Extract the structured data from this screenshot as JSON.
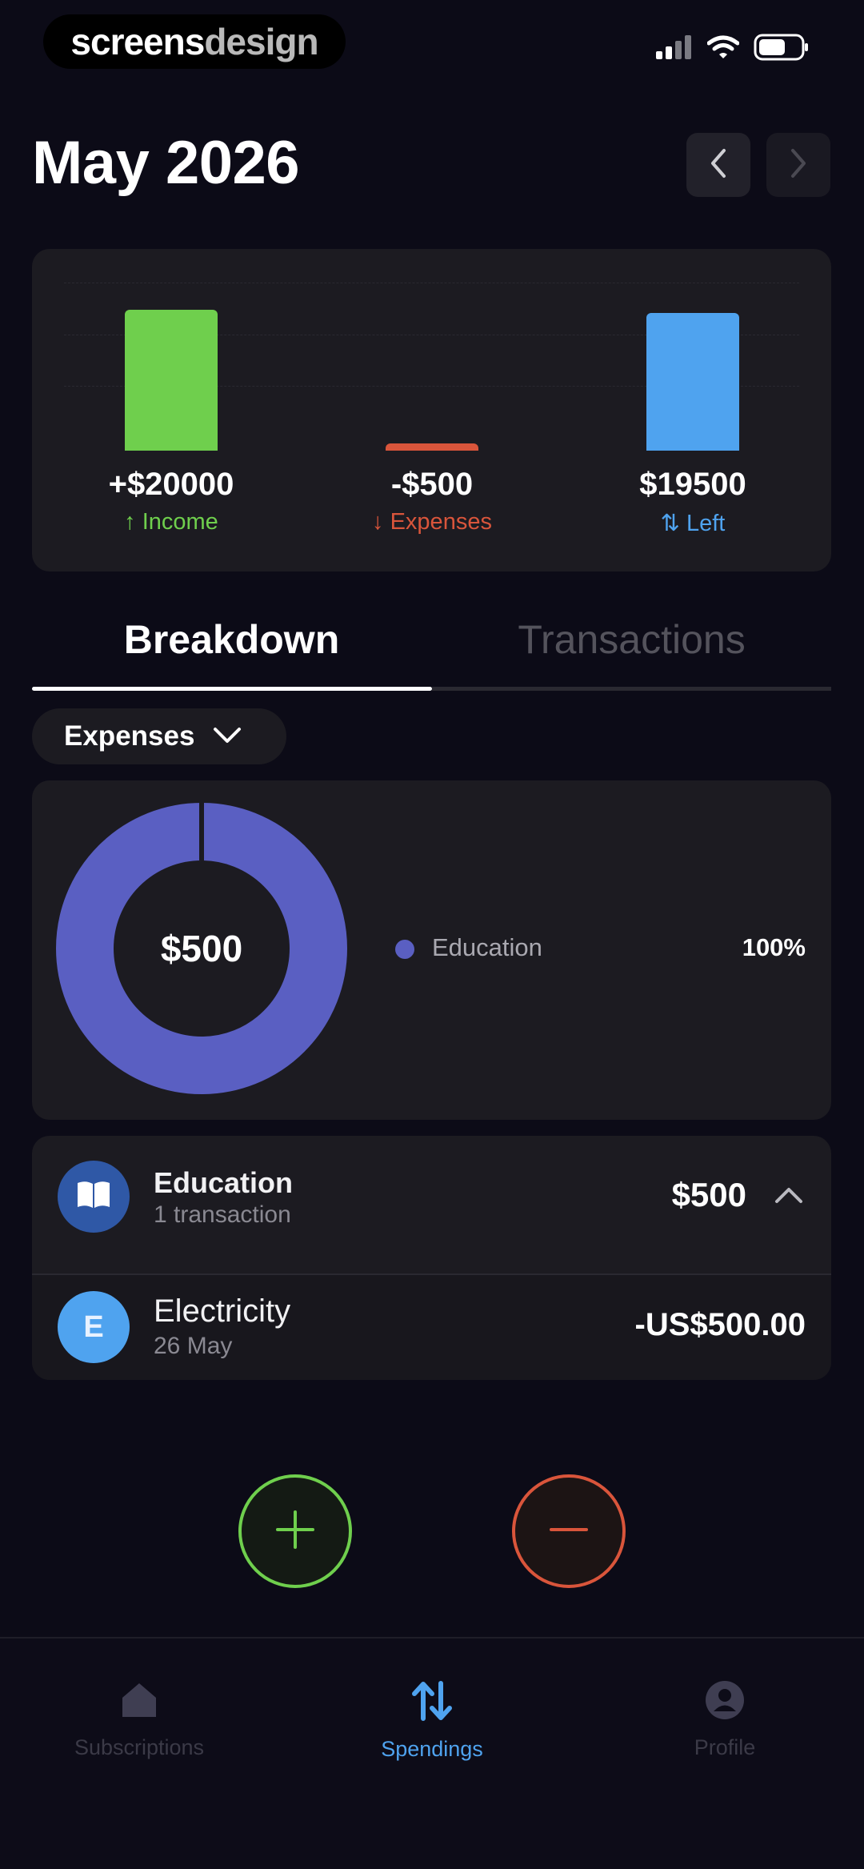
{
  "status_bar": {
    "brand_part1": "screens",
    "brand_part2": "design",
    "icons": [
      "signal-icon",
      "wifi-icon",
      "battery-icon"
    ]
  },
  "header": {
    "title": "May 2026",
    "prev_icon": "chevron-left-icon",
    "next_icon": "chevron-right-icon"
  },
  "summary": {
    "income": {
      "value": "+$20000",
      "label": "↑ Income",
      "color": "#6fcf4d"
    },
    "expenses": {
      "value": "-$500",
      "label": "↓ Expenses",
      "color": "#d9553b"
    },
    "left": {
      "value": "$19500",
      "label": "⇅ Left",
      "color": "#4fa3ef"
    },
    "bar_levels": {
      "income": 1.0,
      "expenses": 0.05,
      "left": 0.975
    }
  },
  "tabs": [
    {
      "label": "Breakdown",
      "active": true
    },
    {
      "label": "Transactions",
      "active": false
    }
  ],
  "filter": {
    "label": "Expenses",
    "icon": "chevron-down-icon"
  },
  "breakdown": {
    "center_total": "$500",
    "legend": [
      {
        "label": "Education",
        "percent": "100%",
        "color": "#5a5fc2"
      }
    ]
  },
  "category": {
    "title": "Education",
    "subtitle": "1 transaction",
    "amount": "$500",
    "icon": "book-icon",
    "expand_icon": "chevron-up-icon",
    "transactions": [
      {
        "avatar_letter": "E",
        "title": "Electricity",
        "date": "26 May",
        "amount": "-US$500.00"
      }
    ]
  },
  "actions": {
    "add_icon": "plus-icon",
    "subtract_icon": "minus-icon"
  },
  "bottom_nav": [
    {
      "label": "Subscriptions",
      "icon": "home-icon",
      "active": false
    },
    {
      "label": "Spendings",
      "icon": "arrows-up-down-icon",
      "active": true
    },
    {
      "label": "Profile",
      "icon": "user-icon",
      "active": false
    }
  ],
  "colors": {
    "background": "#0c0b17",
    "card": "#1c1b21",
    "income": "#6fcf4d",
    "expense": "#d9553b",
    "accent_blue": "#4fa3ef",
    "donut": "#5a5fc2"
  }
}
